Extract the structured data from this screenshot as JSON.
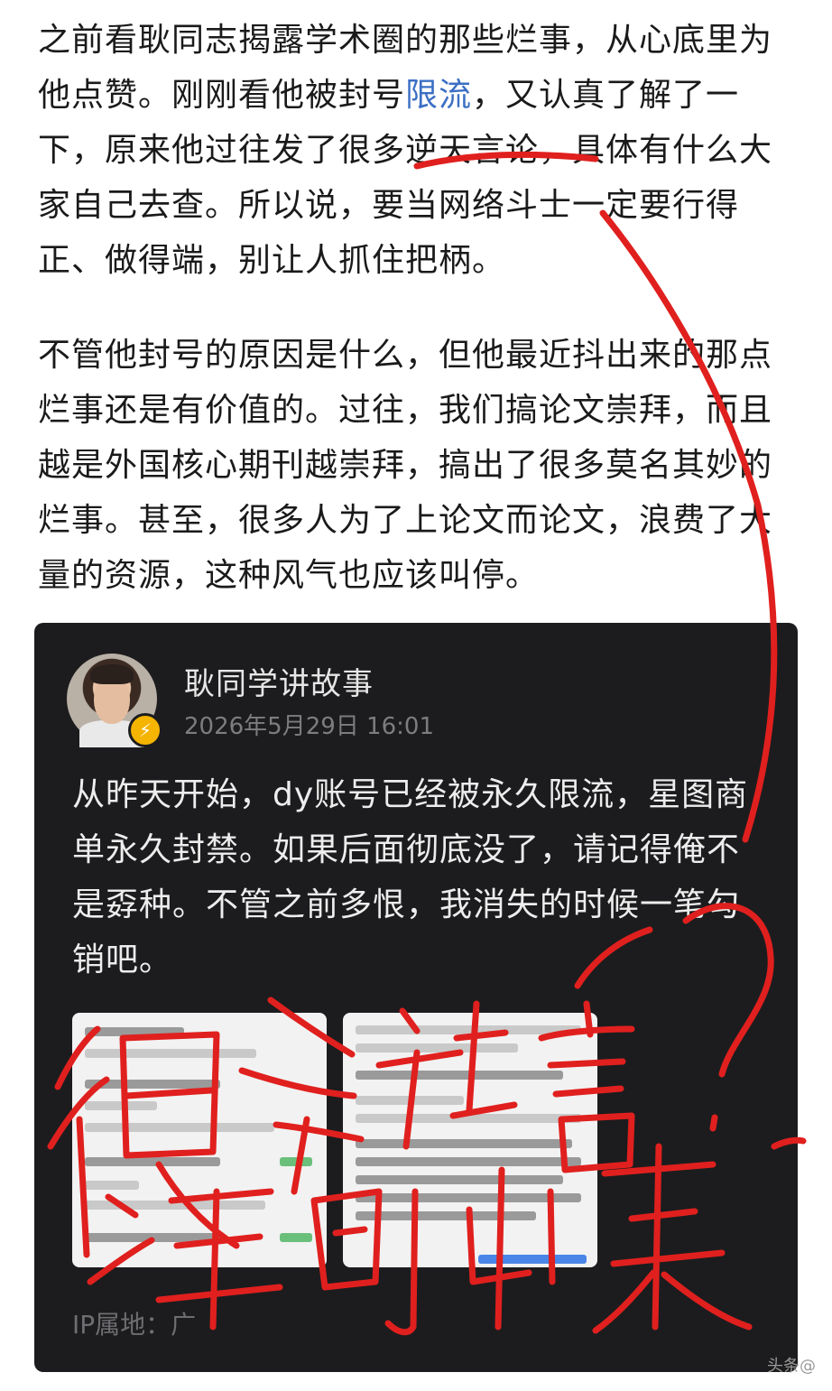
{
  "article": {
    "paragraph_1": {
      "before_link": "之前看耿同志揭露学术圈的那些烂事，从心底里为他点赞。刚刚看他被封号",
      "link": "限流",
      "after_link": "，又认真了解了一下，原来他过往发了很多逆天言论，具体有什么大家自己去查。所以说，要当网络斗士一定要行得正、做得端，别让人抓住把柄。"
    },
    "paragraph_2": "不管他封号的原因是什么，但他最近抖出来的那点烂事还是有价值的。过往，我们搞论文崇拜，而且越是外国核心期刊越崇拜，搞出了很多莫名其妙的烂事。甚至，很多人为了上论文而论文，浪费了大量的资源，这种风气也应该叫停。"
  },
  "embedded_post": {
    "username": "耿同学讲故事",
    "timestamp": "2026年5月29日 16:01",
    "body": "从昨天开始，dy账号已经被永久限流，星图商单永久封禁。如果后面彻底没了，请记得俺不是孬种。不管之前多恨，我消失的时候一笔勾销吧。",
    "ip_label": "IP属地：广"
  },
  "colors": {
    "link": "#3b6fc4",
    "ink": "#e0201e",
    "card_bg": "#1c1c1e"
  },
  "icons": {
    "verified_badge": "lightning-badge-icon"
  }
}
